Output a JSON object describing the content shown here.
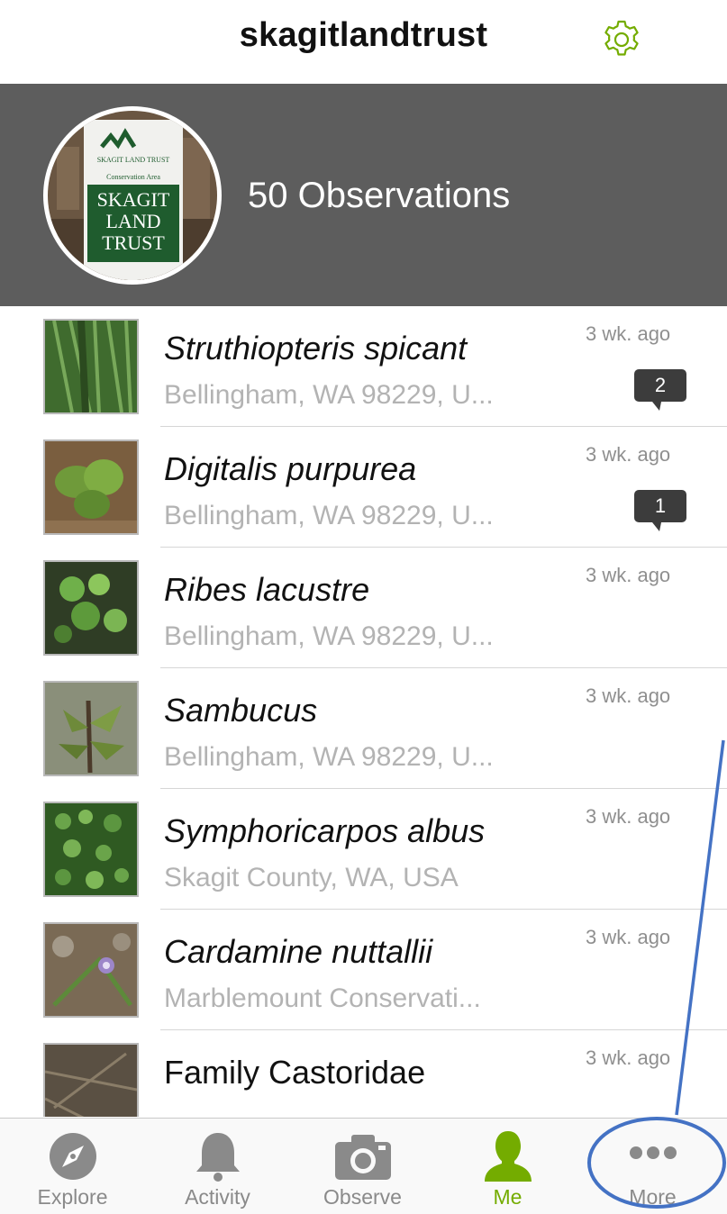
{
  "header": {
    "title": "skagitlandtrust",
    "settings_icon": "gear-icon"
  },
  "profile": {
    "observation_count_label": "50 Observations",
    "avatar_sign": [
      "SKAGIT LAND TRUST",
      "Conservation Area",
      "SKAGIT",
      "LAND",
      "TRUST"
    ]
  },
  "observations": [
    {
      "name": "Struthiopteris spicant",
      "italic": true,
      "place": "Bellingham, WA 98229, U...",
      "time": "3 wk. ago",
      "comments": "2"
    },
    {
      "name": "Digitalis purpurea",
      "italic": true,
      "place": "Bellingham, WA 98229, U...",
      "time": "3 wk. ago",
      "comments": "1"
    },
    {
      "name": "Ribes lacustre",
      "italic": true,
      "place": "Bellingham, WA 98229, U...",
      "time": "3 wk. ago"
    },
    {
      "name": "Sambucus",
      "italic": true,
      "place": "Bellingham, WA 98229, U...",
      "time": "3 wk. ago"
    },
    {
      "name": "Symphoricarpos albus",
      "italic": true,
      "place": "Skagit County, WA, USA",
      "time": "3 wk. ago"
    },
    {
      "name": "Cardamine nuttallii",
      "italic": true,
      "place": "Marblemount Conservati...",
      "time": "3 wk. ago"
    },
    {
      "name": "Family Castoridae",
      "italic": false,
      "place": "",
      "time": "3 wk. ago"
    }
  ],
  "tabs": [
    {
      "label": "Explore",
      "icon": "compass-icon",
      "active": false
    },
    {
      "label": "Activity",
      "icon": "bell-icon",
      "active": false
    },
    {
      "label": "Observe",
      "icon": "camera-icon",
      "active": false
    },
    {
      "label": "Me",
      "icon": "person-icon",
      "active": true
    },
    {
      "label": "More",
      "icon": "more-dots-icon",
      "active": false
    }
  ],
  "colors": {
    "accent": "#74ac00",
    "header_bg": "#5d5d5d",
    "annotation": "#4472c4"
  }
}
